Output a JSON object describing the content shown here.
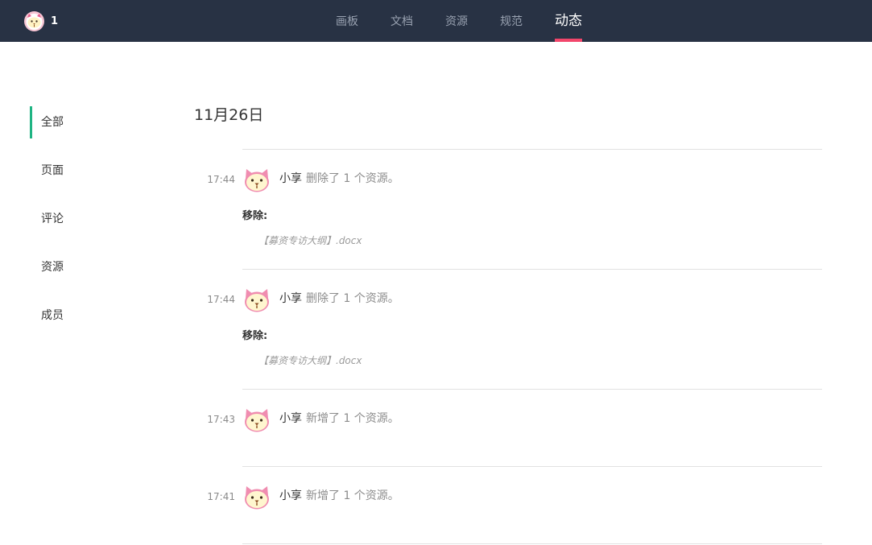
{
  "topbar": {
    "project_name": "1",
    "logo_icon": "cat-logo-icon",
    "nav": [
      {
        "label": "画板",
        "active": false
      },
      {
        "label": "文档",
        "active": false
      },
      {
        "label": "资源",
        "active": false
      },
      {
        "label": "规范",
        "active": false
      },
      {
        "label": "动态",
        "active": true
      }
    ],
    "colors": {
      "bar": "#283244",
      "active_underline": "#f2466b"
    }
  },
  "sidebar": {
    "items": [
      {
        "label": "全部",
        "active": true
      },
      {
        "label": "页面",
        "active": false
      },
      {
        "label": "评论",
        "active": false
      },
      {
        "label": "资源",
        "active": false
      },
      {
        "label": "成员",
        "active": false
      }
    ],
    "colors": {
      "active_marker": "#1fb483"
    }
  },
  "feed": {
    "date": "11月26日",
    "entries": [
      {
        "time": "17:44",
        "user": "小享",
        "action": "删除了 1 个资源。",
        "avatar_icon": "cat-avatar-icon",
        "removed_label": "移除:",
        "file": "【募资专访大纲】.docx"
      },
      {
        "time": "17:44",
        "user": "小享",
        "action": "删除了 1 个资源。",
        "avatar_icon": "cat-avatar-icon",
        "removed_label": "移除:",
        "file": "【募资专访大纲】.docx"
      },
      {
        "time": "17:43",
        "user": "小享",
        "action": "新增了 1 个资源。",
        "avatar_icon": "cat-avatar-icon"
      },
      {
        "time": "17:41",
        "user": "小享",
        "action": "新增了 1 个资源。",
        "avatar_icon": "cat-avatar-icon"
      }
    ]
  }
}
